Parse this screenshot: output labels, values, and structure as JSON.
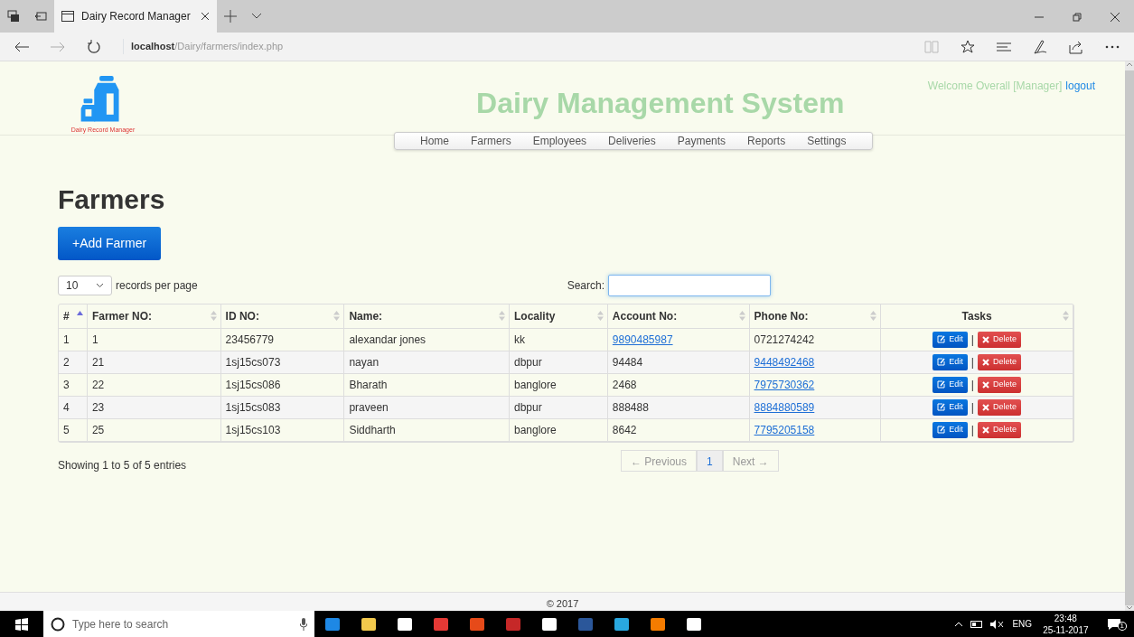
{
  "browser": {
    "tab_title": "Dairy Record Manager",
    "address_host": "localhost",
    "address_path": "/Dairy/farmers/index.php"
  },
  "header": {
    "logo_caption": "Dairy Record Manager",
    "site_title": "Dairy Management System",
    "welcome": "Welcome Overall [Manager]",
    "logout": "logout",
    "nav": [
      {
        "label": "Home"
      },
      {
        "label": "Farmers"
      },
      {
        "label": "Employees"
      },
      {
        "label": "Deliveries"
      },
      {
        "label": "Payments"
      },
      {
        "label": "Reports"
      },
      {
        "label": "Settings"
      }
    ]
  },
  "page": {
    "heading": "Farmers",
    "add_button": "+Add Farmer",
    "page_size": "10",
    "page_size_label": "records per page",
    "search_label": "Search:",
    "columns": [
      {
        "label": "#",
        "sorted": true
      },
      {
        "label": "Farmer NO:",
        "sorted": false
      },
      {
        "label": "ID NO:",
        "sorted": false
      },
      {
        "label": "Name:",
        "sorted": false
      },
      {
        "label": "Locality",
        "sorted": false
      },
      {
        "label": "Account No:",
        "sorted": false
      },
      {
        "label": "Phone No:",
        "sorted": false
      },
      {
        "label": "Tasks",
        "sorted": false
      }
    ],
    "rows": [
      {
        "cells": [
          {
            "text": "1",
            "link": false
          },
          {
            "text": "1",
            "link": false
          },
          {
            "text": "23456779",
            "link": false
          },
          {
            "text": "alexandar jones",
            "link": false
          },
          {
            "text": "kk",
            "link": false
          },
          {
            "text": "9890485987",
            "link": true
          },
          {
            "text": "0721274242",
            "link": false
          }
        ],
        "edit": "Edit",
        "separator": "|",
        "delete": "Delete"
      },
      {
        "cells": [
          {
            "text": "2",
            "link": false
          },
          {
            "text": "21",
            "link": false
          },
          {
            "text": "1sj15cs073",
            "link": false
          },
          {
            "text": "nayan",
            "link": false
          },
          {
            "text": "dbpur",
            "link": false
          },
          {
            "text": "94484",
            "link": false
          },
          {
            "text": "9448492468",
            "link": true
          }
        ],
        "edit": "Edit",
        "separator": "|",
        "delete": "Delete"
      },
      {
        "cells": [
          {
            "text": "3",
            "link": false
          },
          {
            "text": "22",
            "link": false
          },
          {
            "text": "1sj15cs086",
            "link": false
          },
          {
            "text": "Bharath",
            "link": false
          },
          {
            "text": "banglore",
            "link": false
          },
          {
            "text": "2468",
            "link": false
          },
          {
            "text": "7975730362",
            "link": true
          }
        ],
        "edit": "Edit",
        "separator": "|",
        "delete": "Delete"
      },
      {
        "cells": [
          {
            "text": "4",
            "link": false
          },
          {
            "text": "23",
            "link": false
          },
          {
            "text": "1sj15cs083",
            "link": false
          },
          {
            "text": "praveen",
            "link": false
          },
          {
            "text": "dbpur",
            "link": false
          },
          {
            "text": "888488",
            "link": false
          },
          {
            "text": "8884880589",
            "link": true
          }
        ],
        "edit": "Edit",
        "separator": "|",
        "delete": "Delete"
      },
      {
        "cells": [
          {
            "text": "5",
            "link": false
          },
          {
            "text": "25",
            "link": false
          },
          {
            "text": "1sj15cs103",
            "link": false
          },
          {
            "text": "Siddharth",
            "link": false
          },
          {
            "text": "banglore",
            "link": false
          },
          {
            "text": "8642",
            "link": false
          },
          {
            "text": "7795205158",
            "link": true
          }
        ],
        "edit": "Edit",
        "separator": "|",
        "delete": "Delete"
      }
    ],
    "info": "Showing 1 to 5 of 5 entries",
    "pagination": [
      {
        "label": "← Previous",
        "disabled": true,
        "selected": false
      },
      {
        "label": "1",
        "disabled": false,
        "selected": true
      },
      {
        "label": "Next →",
        "disabled": true,
        "selected": false
      }
    ],
    "footer": "© 2017"
  },
  "taskbar": {
    "search_placeholder": "Type here to search",
    "language": "ENG",
    "time": "23:48",
    "date": "25-11-2017",
    "notification_count": "1",
    "apps": [
      {
        "color": "#1e88e5"
      },
      {
        "color": "#f2c94c"
      },
      {
        "color": "#ffffff"
      },
      {
        "color": "#e53935"
      },
      {
        "color": "#e64a19"
      },
      {
        "color": "#c62828"
      },
      {
        "color": "#ffffff"
      },
      {
        "color": "#2b579a"
      },
      {
        "color": "#29a8e0"
      },
      {
        "color": "#f57c00"
      },
      {
        "color": "#ffffff"
      }
    ]
  }
}
